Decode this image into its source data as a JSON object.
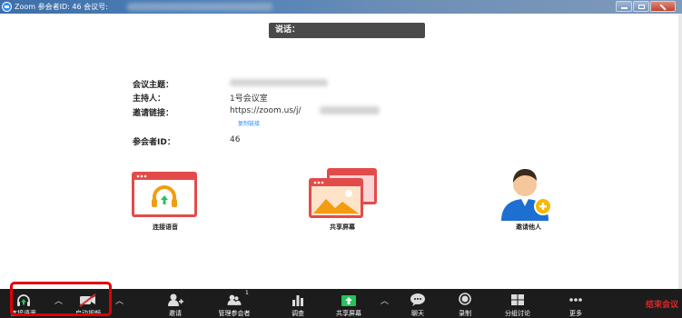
{
  "window": {
    "title": "Zoom 参会者ID: 46   会议号:"
  },
  "talking": {
    "label": "说话："
  },
  "meeting_info": {
    "topic_label": "会议主题：",
    "host_label": "主持人：",
    "host_value": "1号会议室",
    "invite_label": "邀请链接：",
    "invite_value": "https://zoom.us/j/",
    "copy_link": "复制链接",
    "participant_id_label": "参会者ID：",
    "participant_id_value": "46"
  },
  "actions": {
    "join_audio": "连接语音",
    "share_screen": "共享屏幕",
    "invite_others": "邀请他人"
  },
  "toolbar": {
    "join_audio": "连接语音",
    "start_video": "启动视频",
    "invite": "邀请",
    "manage_participants": "管理参会者",
    "participant_count": "1",
    "polling": "调查",
    "share_screen": "共享屏幕",
    "chat": "聊天",
    "record": "录制",
    "breakout_rooms": "分组讨论",
    "more": "更多",
    "end_meeting": "结束会议"
  },
  "colors": {
    "toolbar_bg": "#1c1c1c",
    "accent_red": "#e02828",
    "share_green": "#23c45b",
    "zoom_blue": "#2d8cff"
  }
}
